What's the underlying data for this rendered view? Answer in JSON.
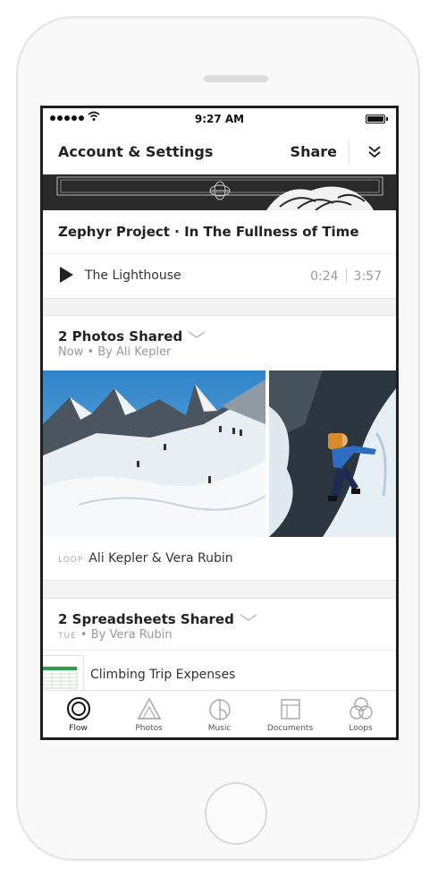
{
  "status_bar": {
    "time": "9:27 AM"
  },
  "nav": {
    "title": "Account & Settings",
    "share_label": "Share"
  },
  "album": {
    "title": "Zephyr Project · In The Fullness of Time",
    "track_title": "The Lighthouse",
    "elapsed": "0:24",
    "duration": "3:57"
  },
  "photos_card": {
    "title": "2 Photos Shared",
    "time": "Now",
    "author": "By Ali Kepler",
    "loop_tag": "LOOP",
    "loop_members": "Ali Kepler & Vera Rubin"
  },
  "sheets_card": {
    "title": "2 Spreadsheets Shared",
    "time": "TUE",
    "author": "By Vera Rubin",
    "file_name": "Climbing Trip Expenses"
  },
  "tabs": [
    {
      "label": "Flow",
      "icon": "flow-icon",
      "active": true
    },
    {
      "label": "Photos",
      "icon": "photos-icon",
      "active": false
    },
    {
      "label": "Music",
      "icon": "music-icon",
      "active": false
    },
    {
      "label": "Documents",
      "icon": "documents-icon",
      "active": false
    },
    {
      "label": "Loops",
      "icon": "loops-icon",
      "active": false
    }
  ],
  "colors": {
    "screen_bg": "#f4f4f4",
    "banner": "#2a2a2a",
    "spreadsheet_green": "#2e9e4f",
    "text_primary": "#222222",
    "text_secondary": "#999999"
  }
}
